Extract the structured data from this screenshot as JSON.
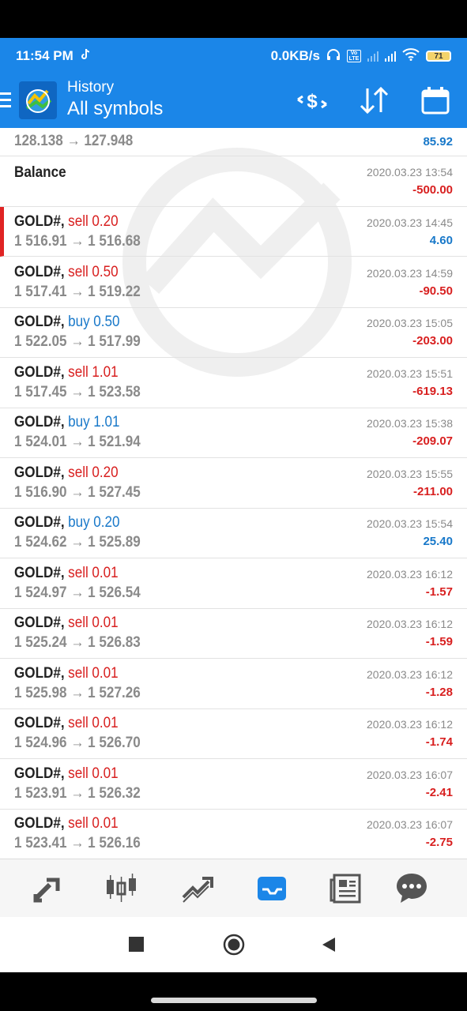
{
  "status_bar": {
    "time": "11:54 PM",
    "net_speed": "0.0KB/s",
    "volte": "Vo LTE",
    "battery": "71"
  },
  "app_bar": {
    "subtitle": "History",
    "title": "All symbols",
    "icons": [
      "menu-icon",
      "metatrader-logo",
      "deposit-withdraw-icon",
      "sort-icon",
      "calendar-icon"
    ]
  },
  "colors": {
    "accent": "#1b86e8",
    "sell": "#d81f1f",
    "buy": "#1878c9",
    "loss": "#d81f1f",
    "profit": "#1878c9"
  },
  "partial_row": {
    "prices": "128.138 → 127.948",
    "profit": "85.92"
  },
  "balance_row": {
    "label": "Balance",
    "datetime": "2020.03.23 13:54",
    "amount": "-500.00"
  },
  "trades": [
    {
      "symbol": "GOLD#,",
      "side": "sell",
      "volume": "0.20",
      "prices": "1 516.91 → 1 516.68",
      "datetime": "2020.03.23 14:45",
      "profit": "4.60",
      "selected": true
    },
    {
      "symbol": "GOLD#,",
      "side": "sell",
      "volume": "0.50",
      "prices": "1 517.41 → 1 519.22",
      "datetime": "2020.03.23 14:59",
      "profit": "-90.50"
    },
    {
      "symbol": "GOLD#,",
      "side": "buy",
      "volume": "0.50",
      "prices": "1 522.05 → 1 517.99",
      "datetime": "2020.03.23 15:05",
      "profit": "-203.00"
    },
    {
      "symbol": "GOLD#,",
      "side": "sell",
      "volume": "1.01",
      "prices": "1 517.45 → 1 523.58",
      "datetime": "2020.03.23 15:51",
      "profit": "-619.13"
    },
    {
      "symbol": "GOLD#,",
      "side": "buy",
      "volume": "1.01",
      "prices": "1 524.01 → 1 521.94",
      "datetime": "2020.03.23 15:38",
      "profit": "-209.07"
    },
    {
      "symbol": "GOLD#,",
      "side": "sell",
      "volume": "0.20",
      "prices": "1 516.90 → 1 527.45",
      "datetime": "2020.03.23 15:55",
      "profit": "-211.00"
    },
    {
      "symbol": "GOLD#,",
      "side": "buy",
      "volume": "0.20",
      "prices": "1 524.62 → 1 525.89",
      "datetime": "2020.03.23 15:54",
      "profit": "25.40"
    },
    {
      "symbol": "GOLD#,",
      "side": "sell",
      "volume": "0.01",
      "prices": "1 524.97 → 1 526.54",
      "datetime": "2020.03.23 16:12",
      "profit": "-1.57"
    },
    {
      "symbol": "GOLD#,",
      "side": "sell",
      "volume": "0.01",
      "prices": "1 525.24 → 1 526.83",
      "datetime": "2020.03.23 16:12",
      "profit": "-1.59"
    },
    {
      "symbol": "GOLD#,",
      "side": "sell",
      "volume": "0.01",
      "prices": "1 525.98 → 1 527.26",
      "datetime": "2020.03.23 16:12",
      "profit": "-1.28"
    },
    {
      "symbol": "GOLD#,",
      "side": "sell",
      "volume": "0.01",
      "prices": "1 524.96 → 1 526.70",
      "datetime": "2020.03.23 16:12",
      "profit": "-1.74"
    },
    {
      "symbol": "GOLD#,",
      "side": "sell",
      "volume": "0.01",
      "prices": "1 523.91 → 1 526.32",
      "datetime": "2020.03.23 16:07",
      "profit": "-2.41"
    },
    {
      "symbol": "GOLD#,",
      "side": "sell",
      "volume": "0.01",
      "prices": "1 523.41 → 1 526.16",
      "datetime": "2020.03.23 16:07",
      "profit": "-2.75"
    }
  ],
  "bottom_nav": {
    "items": [
      "quotes-icon",
      "chart-icon",
      "trade-icon",
      "history-icon",
      "news-icon",
      "messages-icon"
    ],
    "active": "history-icon"
  },
  "system_nav": [
    "recents-icon",
    "home-icon",
    "back-icon"
  ]
}
